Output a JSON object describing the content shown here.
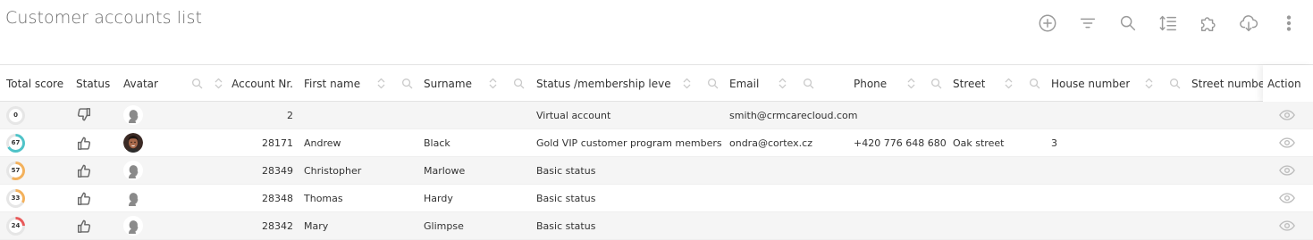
{
  "page": {
    "title": "Customer accounts list"
  },
  "toolbar": {
    "tools": [
      {
        "name": "add-icon"
      },
      {
        "name": "filter-icon"
      },
      {
        "name": "search-icon"
      },
      {
        "name": "row-height-icon"
      },
      {
        "name": "puzzle-icon"
      },
      {
        "name": "cloud-download-icon"
      },
      {
        "name": "more-vertical-icon"
      }
    ]
  },
  "table": {
    "columns": [
      {
        "key": "score",
        "label": "Total score"
      },
      {
        "key": "status",
        "label": "Status"
      },
      {
        "key": "avatar",
        "label": "Avatar"
      },
      {
        "key": "account",
        "label": "Account Nr."
      },
      {
        "key": "first_name",
        "label": "First name"
      },
      {
        "key": "surname",
        "label": "Surname"
      },
      {
        "key": "membership",
        "label": "Status /membership level"
      },
      {
        "key": "email",
        "label": "Email"
      },
      {
        "key": "phone",
        "label": "Phone"
      },
      {
        "key": "street",
        "label": "Street"
      },
      {
        "key": "house_number",
        "label": "House number"
      },
      {
        "key": "street_number",
        "label": "Street number"
      }
    ],
    "action_label": "Action",
    "rows": [
      {
        "score": "0",
        "score_value": 0,
        "score_color": "#cfcfcf",
        "status": "thumbs-down-icon",
        "avatar": "silhouette",
        "account": "2",
        "first_name": "",
        "surname": "",
        "membership": "Virtual account",
        "email": "smith@crmcarecloud.com",
        "phone": "",
        "street": "",
        "house_number": "",
        "street_number": ""
      },
      {
        "score": "67",
        "score_value": 67,
        "score_color": "#4fc3c8",
        "status": "thumbs-up-icon",
        "avatar": "photo",
        "account": "28171",
        "first_name": "Andrew",
        "surname": "Black",
        "membership": "Gold VIP customer program members",
        "email": "ondra@cortex.cz",
        "phone": "+420 776 648 680",
        "street": "Oak street",
        "house_number": "3",
        "street_number": ""
      },
      {
        "score": "57",
        "score_value": 57,
        "score_color": "#f3b15c",
        "status": "thumbs-up-icon",
        "avatar": "silhouette",
        "account": "28349",
        "first_name": "Christopher",
        "surname": "Marlowe",
        "membership": "Basic status",
        "email": "",
        "phone": "",
        "street": "",
        "house_number": "",
        "street_number": ""
      },
      {
        "score": "33",
        "score_value": 33,
        "score_color": "#f3b15c",
        "status": "thumbs-up-icon",
        "avatar": "silhouette",
        "account": "28348",
        "first_name": "Thomas",
        "surname": "Hardy",
        "membership": "Basic status",
        "email": "",
        "phone": "",
        "street": "",
        "house_number": "",
        "street_number": ""
      },
      {
        "score": "24",
        "score_value": 24,
        "score_color": "#e85a5a",
        "status": "thumbs-up-icon",
        "avatar": "silhouette",
        "account": "28342",
        "first_name": "Mary",
        "surname": "Glimpse",
        "membership": "Basic status",
        "email": "",
        "phone": "",
        "street": "",
        "house_number": "",
        "street_number": ""
      }
    ]
  }
}
